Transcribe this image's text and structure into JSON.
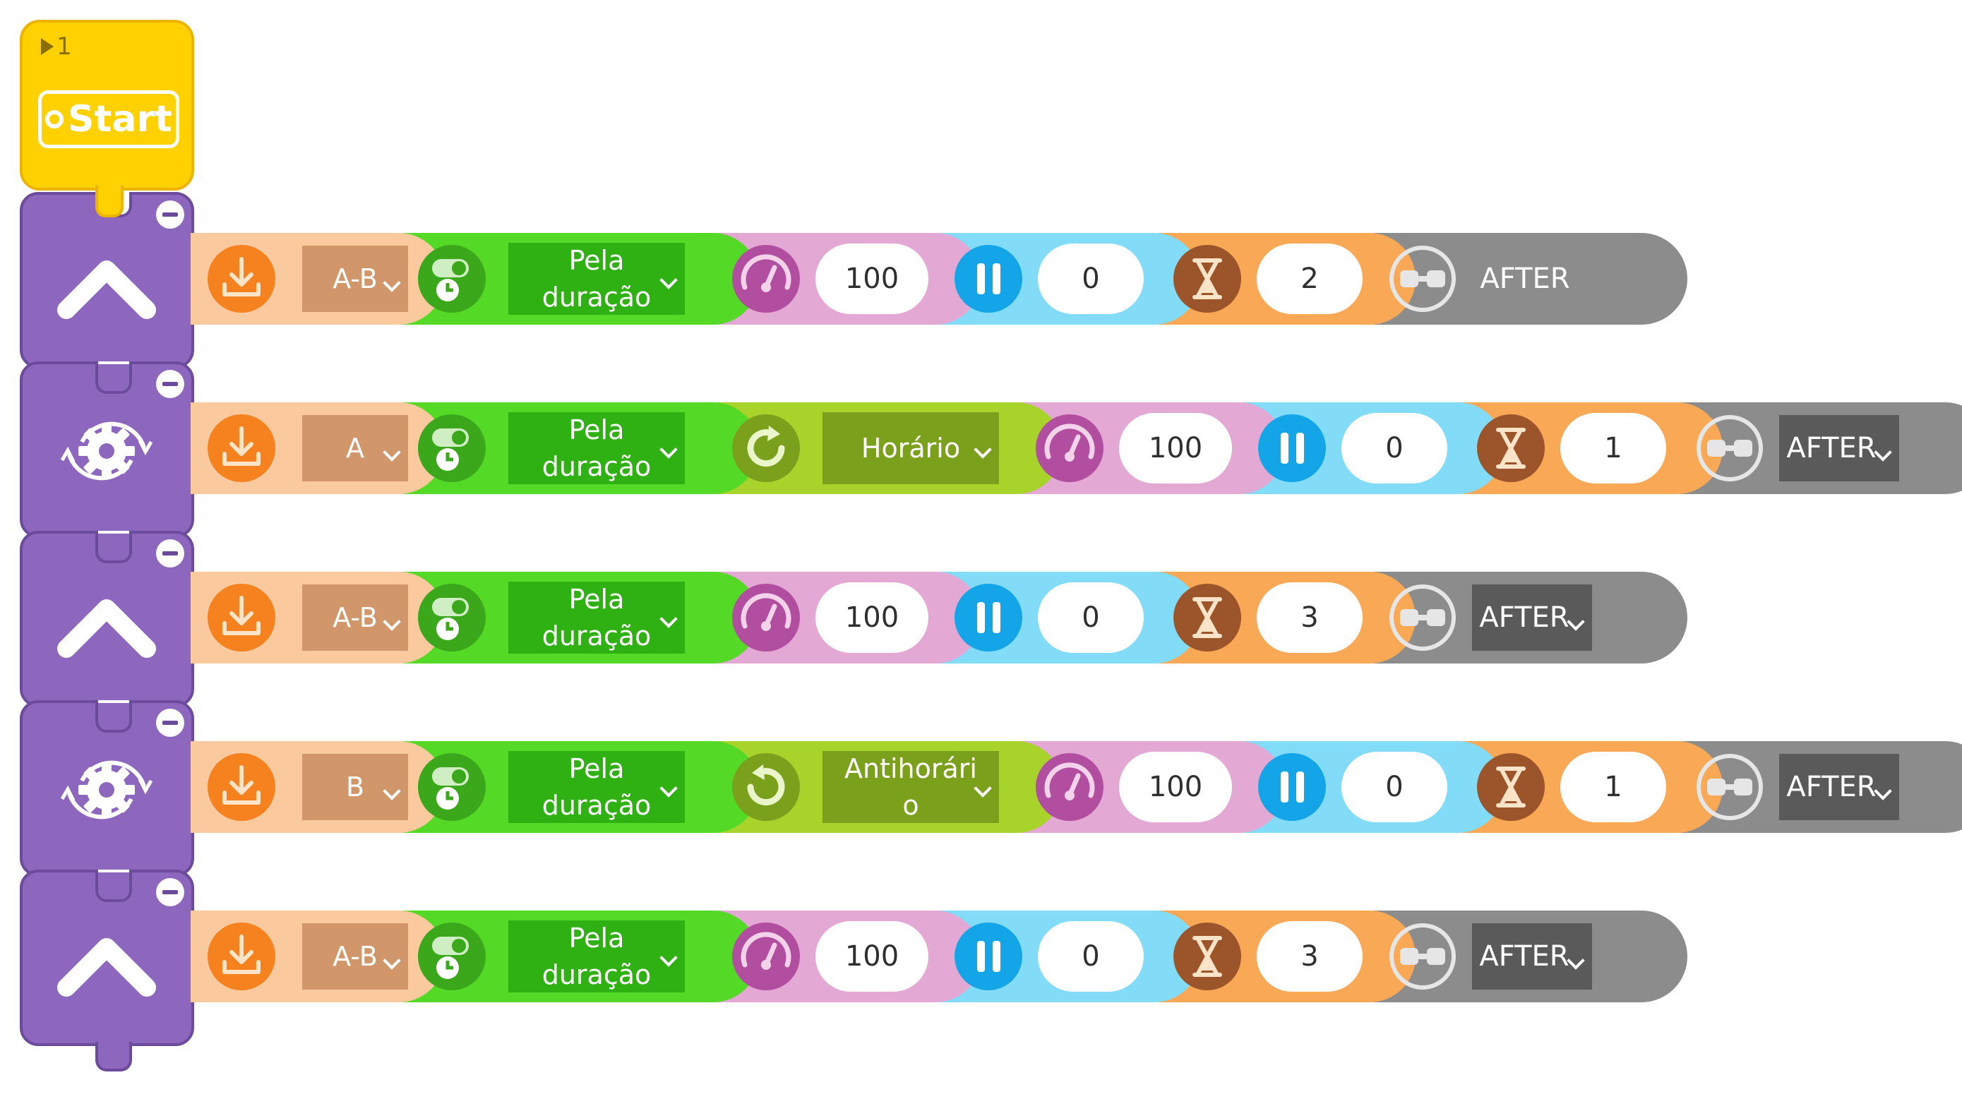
{
  "start": {
    "index": "1",
    "label": "Start"
  },
  "rows": [
    {
      "icon": "up-arrow-icon",
      "port": "A-B",
      "mode": "Pela duração",
      "direction": null,
      "speed": "100",
      "pause": "0",
      "duration": "2",
      "after": "AFTER"
    },
    {
      "icon": "rotate-gear-icon",
      "port": "A",
      "mode": "Pela duração",
      "direction": "Horário",
      "speed": "100",
      "pause": "0",
      "duration": "1",
      "after": "AFTER"
    },
    {
      "icon": "up-arrow-icon",
      "port": "A-B",
      "mode": "Pela duração",
      "direction": null,
      "speed": "100",
      "pause": "0",
      "duration": "3",
      "after": "AFTER"
    },
    {
      "icon": "rotate-gear-icon",
      "port": "B",
      "mode": "Pela duração",
      "direction": "Antihorário",
      "speed": "100",
      "pause": "0",
      "duration": "1",
      "after": "AFTER"
    },
    {
      "icon": "up-arrow-icon",
      "port": "A-B",
      "mode": "Pela duração",
      "direction": null,
      "speed": "100",
      "pause": "0",
      "duration": "3",
      "after": "AFTER"
    }
  ],
  "colors": {
    "start": "#ffd100",
    "motor": "#8d67bd",
    "port": "#fac99e",
    "mode": "#55d927",
    "direction": "#a7d32a",
    "speed": "#e3a8d3",
    "pause": "#82dcf7",
    "duration": "#f9a855",
    "after": "#8c8c8c"
  }
}
